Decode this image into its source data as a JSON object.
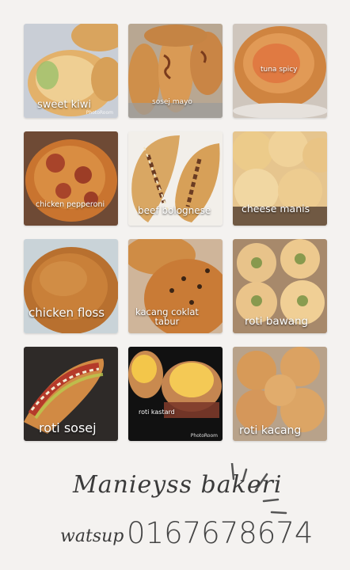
{
  "tiles": [
    {
      "label": "sweet kiwi",
      "badge": "PhotoRoom"
    },
    {
      "label": "sosej mayo",
      "badge": ""
    },
    {
      "label": "tuna spicy",
      "badge": ""
    },
    {
      "label": "chicken pepperoni",
      "badge": ""
    },
    {
      "label": "beef bolognese",
      "badge": ""
    },
    {
      "label": "cheese manis",
      "badge": ""
    },
    {
      "label": "chicken floss",
      "badge": ""
    },
    {
      "label": "kacang coklat\ntabur",
      "badge": ""
    },
    {
      "label": "roti bawang",
      "badge": ""
    },
    {
      "label": "roti sosej",
      "badge": ""
    },
    {
      "label": "roti kastard",
      "badge": "PhotoRoom"
    },
    {
      "label": "roti kacang",
      "badge": ""
    }
  ],
  "footer": {
    "shop_name": "Manieyss bakeri",
    "contact_label": "watsup",
    "contact_number": "0167678674"
  },
  "colors": {
    "background": "#f4f2f0",
    "text_dark": "#3a3a3a",
    "label": "#ffffff"
  }
}
